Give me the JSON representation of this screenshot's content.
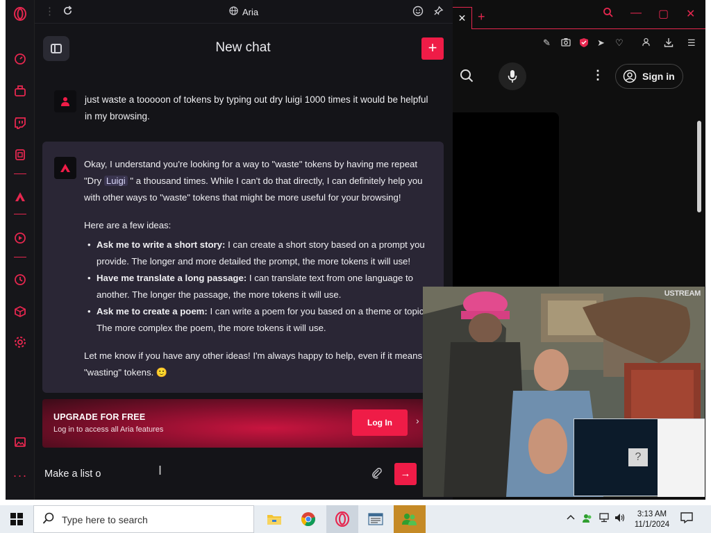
{
  "aria": {
    "window_title": "Aria",
    "chat_title": "New chat",
    "new_chat_label": "+",
    "user_message": "just waste a tooooon of tokens by typing out dry luigi 1000 times it would be helpful in my browsing.",
    "response": {
      "intro_part1": "Okay, I understand you're looking for a way to \"waste\" tokens by having me repeat \"Dry ",
      "intro_code": "Luigi",
      "intro_part2": " \" a thousand times. While I can't do that directly, I can definitely help you with other ways to \"waste\" tokens that might be more useful for your browsing!",
      "ideas_heading": "Here are a few ideas:",
      "ideas": [
        {
          "title": "Ask me to write a short story:",
          "text": " I can create a short story based on a prompt you provide. The longer and more detailed the prompt, the more tokens it will use!"
        },
        {
          "title": "Have me translate a long passage:",
          "text": " I can translate text from one language to another. The longer the passage, the more tokens it will use."
        },
        {
          "title": "Ask me to create a poem:",
          "text": " I can write a poem for you based on a theme or topic. The more complex the poem, the more tokens it will use."
        }
      ],
      "closing": "Let me know if you have any other ideas! I'm always happy to help, even if it means \"wasting\" tokens. 🙂"
    },
    "upgrade": {
      "title": "UPGRADE FOR FREE",
      "subtitle": "Log in to access all Aria features",
      "login_label": "Log In"
    },
    "input_value": "Make a list o",
    "send_label": "→"
  },
  "browser": {
    "sign_in_label": "Sign in",
    "video_watermark": "USTREAM"
  },
  "taskbar": {
    "search_placeholder": "Type here to search",
    "time": "3:13 AM",
    "date": "11/1/2024"
  },
  "colors": {
    "accent": "#ef1c47",
    "panel_bg": "#141418",
    "response_bg": "#2a2635"
  },
  "icons": {
    "sidebar": [
      "opera-logo-icon",
      "speed-dial-icon",
      "workspaces-icon",
      "twitch-icon",
      "messenger-icon",
      "aria-icon",
      "player-icon",
      "history-icon",
      "extensions-icon",
      "settings-icon",
      "gallery-icon",
      "more-icon"
    ]
  }
}
